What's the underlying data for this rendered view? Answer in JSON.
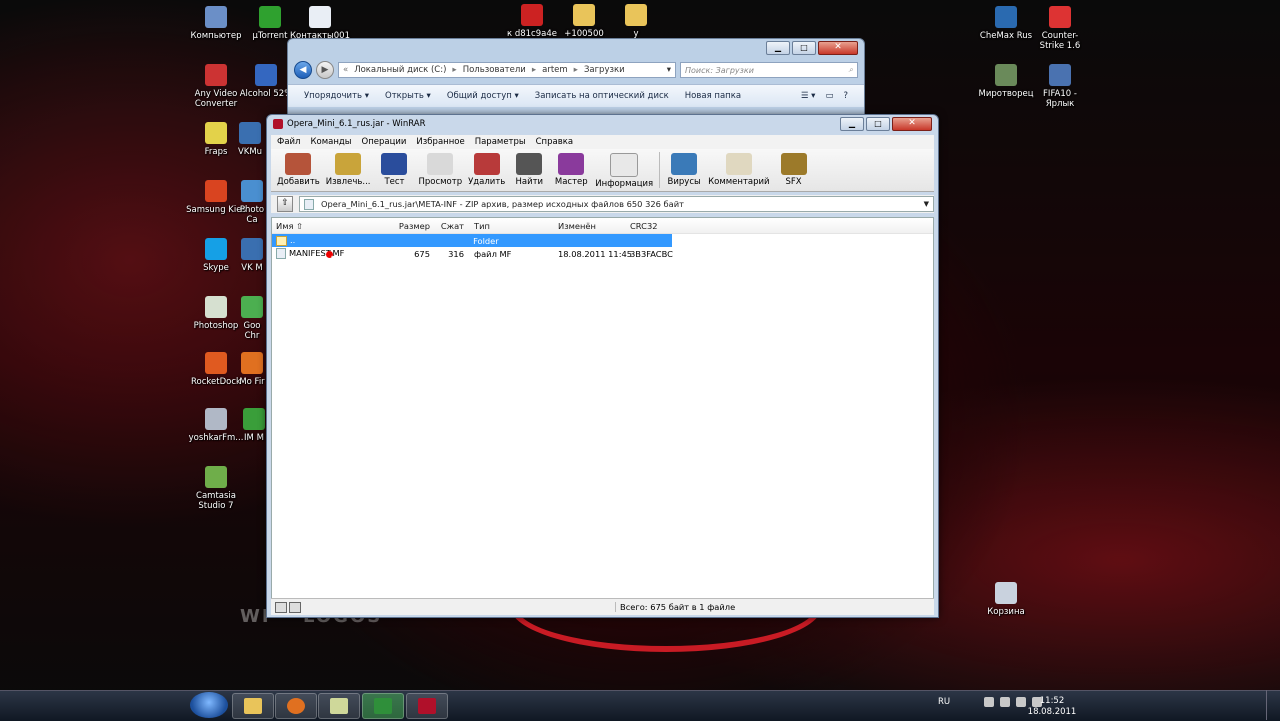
{
  "desktop": {
    "icons": [
      {
        "label": "Компьютер",
        "color": "#6b8fc7"
      },
      {
        "label": "µTorrent",
        "color": "#2fa12f"
      },
      {
        "label": "Контакты001",
        "color": "#e9eef5"
      },
      {
        "label": "к d81c9a4e",
        "color": "#c22"
      },
      {
        "label": "+100500",
        "color": "#e9c45a"
      },
      {
        "label": "у",
        "color": "#e9c45a"
      },
      {
        "label": "Any Video Converter",
        "color": "#c33"
      },
      {
        "label": "Alcohol 52%",
        "color": "#3467c0"
      },
      {
        "label": "Fraps",
        "color": "#e3d24a"
      },
      {
        "label": "VKMu",
        "color": "#3a6fb0"
      },
      {
        "label": "Samsung Kies",
        "color": "#d94420"
      },
      {
        "label": "Photo Ca",
        "color": "#4a8fd0"
      },
      {
        "label": "Skype",
        "color": "#15a0e6"
      },
      {
        "label": "VK M",
        "color": "#3a6fb0"
      },
      {
        "label": "Photoshop",
        "color": "#d6e0d0"
      },
      {
        "label": "Goo Chr",
        "color": "#4caf50"
      },
      {
        "label": "RocketDock",
        "color": "#e05a20"
      },
      {
        "label": "Mo Fir",
        "color": "#e07020"
      },
      {
        "label": "yoshkarFm...",
        "color": "#b0b8c6"
      },
      {
        "label": "IM M",
        "color": "#3a9e3a"
      },
      {
        "label": "Camtasia Studio 7",
        "color": "#6fae4a"
      },
      {
        "label": "CheMax Rus",
        "color": "#2a6ab0"
      },
      {
        "label": "Counter-Strike 1.6",
        "color": "#d33"
      },
      {
        "label": "Миротворец",
        "color": "#6a8a5a"
      },
      {
        "label": "FIFA10 - Ярлык",
        "color": "#4a72b0"
      },
      {
        "label": "Корзина",
        "color": "#c9d2de"
      }
    ],
    "watermark": "WP - LOGOS"
  },
  "explorer": {
    "address_parts": [
      "Локальный диск (C:)",
      "Пользователи",
      "artem",
      "Загрузки"
    ],
    "search_placeholder": "Поиск: Загрузки",
    "toolbar": [
      "Упорядочить ▾",
      "Открыть ▾",
      "Общий доступ ▾",
      "Записать на оптический диск",
      "Новая папка"
    ]
  },
  "winrar": {
    "title": "Opera_Mini_6.1_rus.jar - WinRAR",
    "menu": [
      "Файл",
      "Команды",
      "Операции",
      "Избранное",
      "Параметры",
      "Справка"
    ],
    "tools": [
      {
        "label": "Добавить",
        "color": "#b5543a"
      },
      {
        "label": "Извлечь...",
        "color": "#c9a43a"
      },
      {
        "label": "Тест",
        "color": "#2a4d9c"
      },
      {
        "label": "Просмотр",
        "color": "#d9d9d9"
      },
      {
        "label": "Удалить",
        "color": "#b83a3a"
      },
      {
        "label": "Найти",
        "color": "#555"
      },
      {
        "label": "Мастер",
        "color": "#8a3a9c"
      },
      {
        "label": "Информация",
        "color": "#e8e8e8"
      },
      {
        "label": "Вирусы",
        "color": "#3a7ab8"
      },
      {
        "label": "Комментарий",
        "color": "#e0d8c0"
      },
      {
        "label": "SFX",
        "color": "#9c7a2a"
      }
    ],
    "path": "Opera_Mini_6.1_rus.jar\\META-INF - ZIP архив, размер исходных файлов 650 326 байт",
    "columns": {
      "name": "Имя",
      "size": "Размер",
      "packed": "Сжат",
      "type": "Тип",
      "modified": "Изменён",
      "crc": "CRC32"
    },
    "rows": [
      {
        "name": "..",
        "size": "",
        "packed": "",
        "type": "Folder",
        "modified": "",
        "crc": ""
      },
      {
        "name": "MANIFEST.MF",
        "size": "675",
        "packed": "316",
        "type": "файл MF",
        "modified": "18.08.2011 11:45",
        "crc": "3B3FACBC"
      }
    ],
    "status": "Всего: 675 байт в 1 файле"
  },
  "taskbar": {
    "lang": "RU",
    "time": "11:52",
    "date": "18.08.2011",
    "apps": [
      {
        "name": "explorer",
        "color": "#e9c45a"
      },
      {
        "name": "firefox",
        "color": "#e07020"
      },
      {
        "name": "notes",
        "color": "#cfd89a"
      },
      {
        "name": "utility",
        "color": "#2f8f3a"
      },
      {
        "name": "winrar",
        "color": "#b0102a"
      }
    ]
  }
}
